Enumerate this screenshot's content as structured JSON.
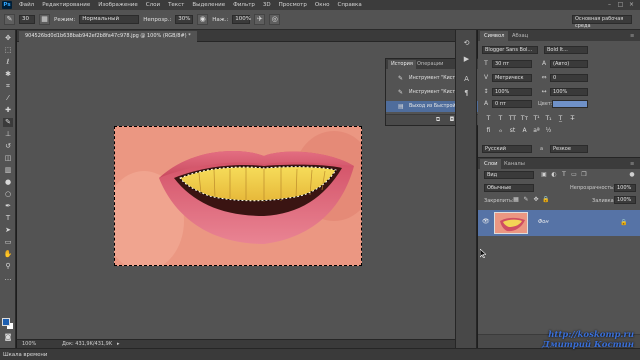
{
  "app": {
    "logo": "Ps"
  },
  "menu": [
    "Файл",
    "Редактирование",
    "Изображение",
    "Слои",
    "Текст",
    "Выделение",
    "Фильтр",
    "3D",
    "Просмотр",
    "Окно",
    "Справка"
  ],
  "options": {
    "brush_size": "30",
    "mode_label": "Режим:",
    "mode_value": "Нормальный",
    "opacity_label": "Непрозр.:",
    "opacity_value": "30%",
    "pressure_label": "Наж.:",
    "pressure_value": "100%",
    "workspace": "Основная рабочая среда"
  },
  "document": {
    "tab_title": "904526bd0d1b638bab942ef2b8fa47c978.jpg @ 100% (RGB/8#) *",
    "zoom": "100%",
    "doc_info": "Док: 431,9K/431,9K"
  },
  "timeline": {
    "label": "Шкала времени"
  },
  "history": {
    "tabs": [
      "История",
      "Операции"
    ],
    "items": [
      "Инструмент \"Кисть\"",
      "Инструмент \"Кисть\"",
      "Выход из Быстрой маски"
    ],
    "selected_index": 2
  },
  "character": {
    "tabs": [
      "Символ",
      "Абзац"
    ],
    "font_family": "Blogger Sans Bol...",
    "font_style": "Bold It...",
    "font_size": "30 пт",
    "leading": "(Авто)",
    "kerning": "Метрическ",
    "tracking": "0",
    "vertical_scale": "100%",
    "horizontal_scale": "100%",
    "baseline": "0 пт",
    "color_label": "Цвет:",
    "language": "Русский",
    "antialias": "Резкое",
    "aa_label": "a",
    "color": "#6f91c8"
  },
  "layers": {
    "tabs": [
      "Слои",
      "Каналы"
    ],
    "filter_label": "Вид",
    "blend_mode": "Обычные",
    "opacity_label": "Непрозрачность:",
    "opacity_value": "100%",
    "lock_label": "Закрепить:",
    "fill_label": "Заливка:",
    "fill_value": "100%",
    "items": [
      {
        "name": "Фон",
        "locked": true,
        "visible": true
      }
    ]
  },
  "watermark": {
    "url": "http://koskomp.ru",
    "author": "Дмитрий Костин"
  },
  "colors": {
    "foreground": "#1e5fb0",
    "background": "#ffffff",
    "selection_highlight": "#5673a6"
  }
}
